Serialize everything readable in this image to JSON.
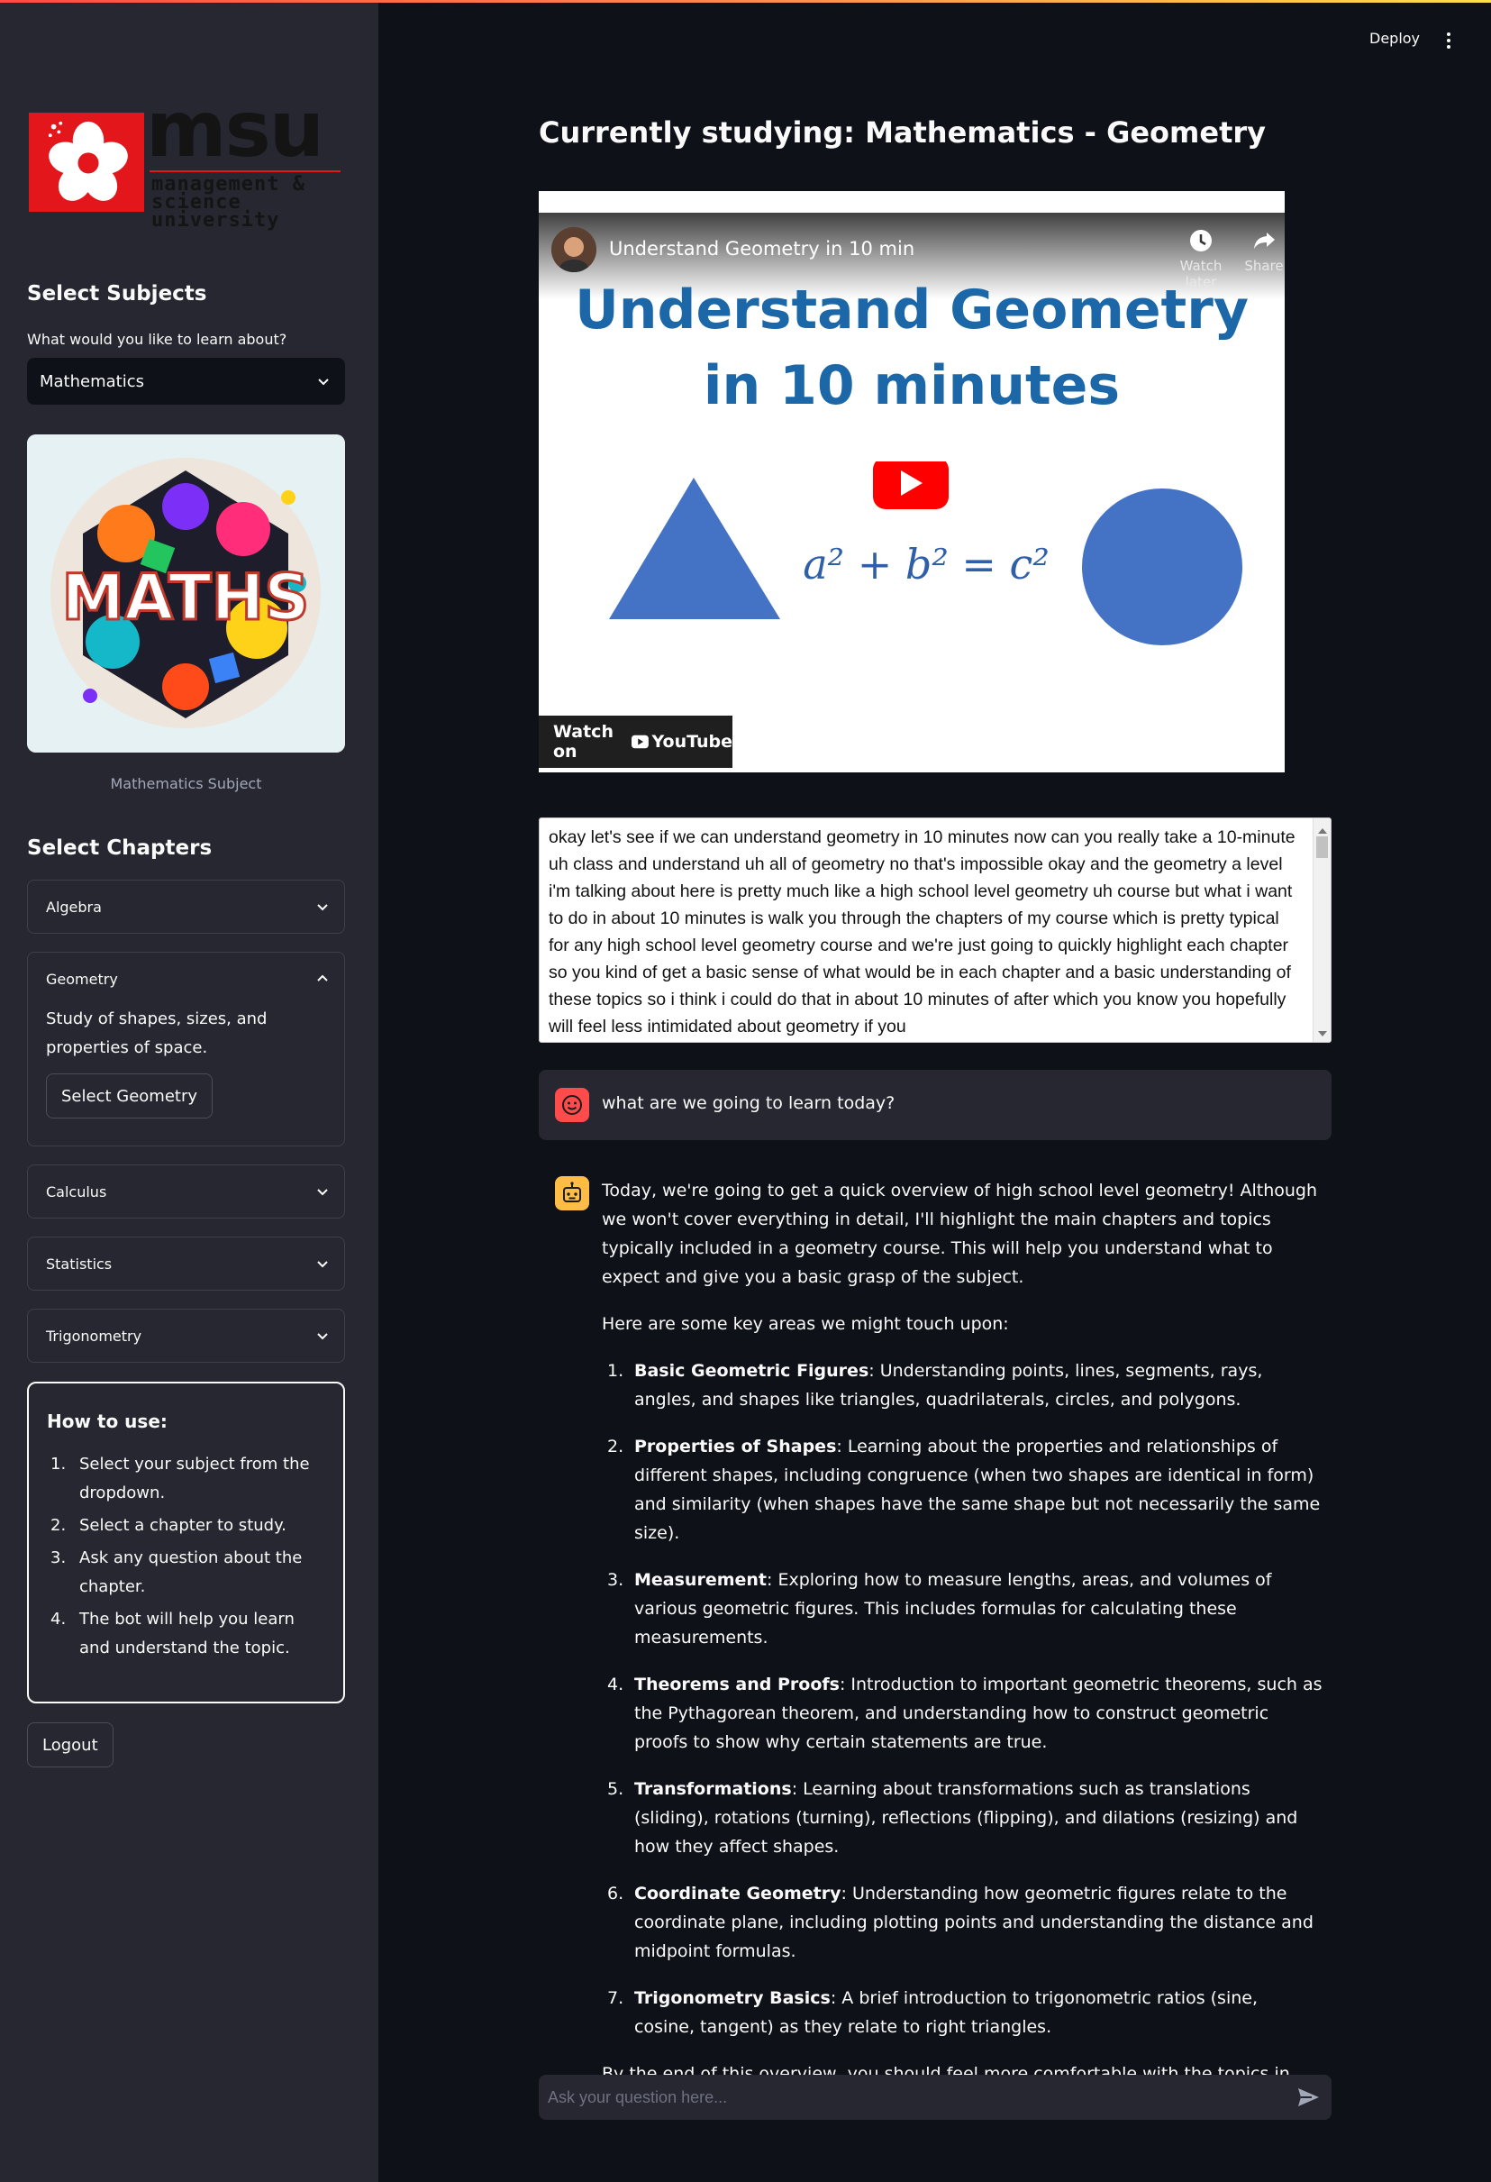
{
  "header": {
    "deploy_label": "Deploy",
    "menu_icon": "kebab-menu-icon"
  },
  "sidebar": {
    "logo": {
      "brand": "msu",
      "subtitle_line1": "management &",
      "subtitle_line2": "science university"
    },
    "select_subjects_heading": "Select Subjects",
    "subject_prompt": "What would you like to learn about?",
    "subject_value": "Mathematics",
    "subject_image_text": "MATHS",
    "subject_caption": "Mathematics Subject",
    "select_chapters_heading": "Select Chapters",
    "chapters": [
      {
        "label": "Algebra",
        "expanded": false
      },
      {
        "label": "Geometry",
        "expanded": true,
        "description": "Study of shapes, sizes, and properties of space.",
        "button": "Select Geometry"
      },
      {
        "label": "Calculus",
        "expanded": false
      },
      {
        "label": "Statistics",
        "expanded": false
      },
      {
        "label": "Trigonometry",
        "expanded": false
      }
    ],
    "how_to": {
      "title": "How to use:",
      "steps": [
        "Select your subject from the dropdown.",
        "Select a chapter to study.",
        "Ask any question about the chapter.",
        "The bot will help you learn and understand the topic."
      ]
    },
    "logout_label": "Logout"
  },
  "main": {
    "title": "Currently studying: Mathematics - Geometry",
    "video": {
      "title": "Understand Geometry in 10 min",
      "watch_later": "Watch later",
      "share": "Share",
      "big_line1": "Understand Geometry",
      "big_line2": "in 10 minutes",
      "equation": "a² + b² = c²",
      "watch_on": "Watch on",
      "youtube": "YouTube"
    },
    "transcript": "okay let's see if we can understand geometry in 10 minutes now can you really take a 10-minute uh class and understand uh all of geometry no that's impossible okay and the geometry a level i'm talking about here is pretty much like a high school level geometry uh course but what i want to do in about 10 minutes is walk you through the chapters of my course which is pretty typical for any high school level geometry course and we're just going to quickly highlight each chapter so you kind of get a basic sense of what would be in each chapter and a basic understanding of these topics so i think i could do that in about 10 minutes of after which you know you hopefully will feel less intimidated about geometry if you",
    "user_message": "what are we going to learn today?",
    "bot": {
      "intro": "Today, we're going to get a quick overview of high school level geometry! Although we won't cover everything in detail, I'll highlight the main chapters and topics typically included in a geometry course. This will help you understand what to expect and give you a basic grasp of the subject.",
      "lead": "Here are some key areas we might touch upon:",
      "items": [
        {
          "num": "1.",
          "term": "Basic Geometric Figures",
          "sep": ": ",
          "text": "Understanding points, lines, segments, rays, angles, and shapes like triangles, quadrilaterals, circles, and polygons."
        },
        {
          "num": "2.",
          "term": "Properties of Shapes",
          "sep": ": ",
          "text": "Learning about the properties and relationships of different shapes, including congruence (when two shapes are identical in form) and similarity (when shapes have the same shape but not necessarily the same size)."
        },
        {
          "num": "3.",
          "term": "Measurement",
          "sep": ": ",
          "text": "Exploring how to measure lengths, areas, and volumes of various geometric figures. This includes formulas for calculating these measurements."
        },
        {
          "num": "4.",
          "term": "Theorems and Proofs",
          "sep": ": ",
          "text": "Introduction to important geometric theorems, such as the Pythagorean theorem, and understanding how to construct geometric proofs to show why certain statements are true."
        },
        {
          "num": "5.",
          "term": "Transformations",
          "sep": ": ",
          "text": "Learning about transformations such as translations (sliding), rotations (turning), reflections (flipping), and dilations (resizing) and how they affect shapes."
        },
        {
          "num": "6.",
          "term": "Coordinate Geometry",
          "sep": ": ",
          "text": "Understanding how geometric figures relate to the coordinate plane, including plotting points and understanding the distance and midpoint formulas."
        },
        {
          "num": "7.",
          "term": "Trigonometry Basics",
          "sep": ": ",
          "text": "A brief introduction to trigonometric ratios (sine, cosine, tangent) as they relate to right triangles."
        }
      ],
      "outro": "By the end of this overview, you should feel more comfortable with the topics in geometry and be more prepared to dive deeper into each one. Let's get started!"
    },
    "input_placeholder": "Ask your question here..."
  },
  "colors": {
    "app_bg": "#0e1117",
    "sidebar_bg": "#262730",
    "accent_red": "#ff4b4b",
    "bot_avatar": "#ffbd45",
    "video_title_blue": "#1c67a8",
    "shape_blue": "#4472c4"
  }
}
